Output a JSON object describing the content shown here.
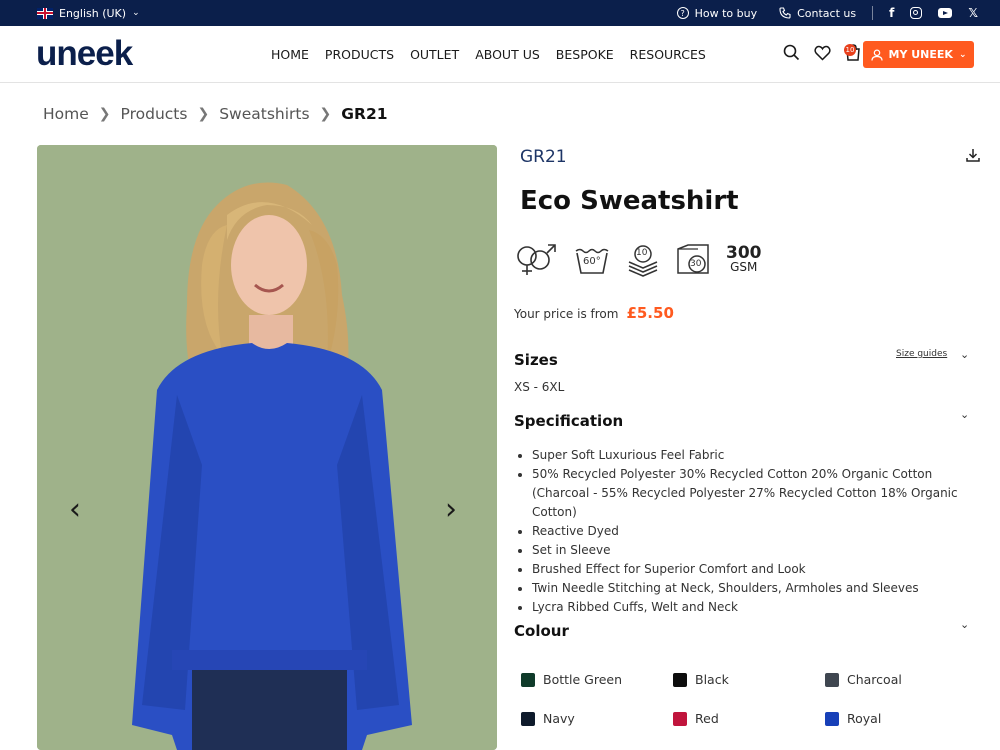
{
  "topbar": {
    "language": "English (UK)",
    "how_to_buy": "How to buy",
    "contact_us": "Contact us"
  },
  "header": {
    "logo": "uneek",
    "nav": [
      "HOME",
      "PRODUCTS",
      "OUTLET",
      "ABOUT US",
      "BESPOKE",
      "RESOURCES"
    ],
    "cart_count": "10",
    "account_label": "MY UNEEK"
  },
  "breadcrumb": [
    "Home",
    "Products",
    "Sweatshirts",
    "GR21"
  ],
  "product": {
    "code": "GR21",
    "name": "Eco Sweatshirt",
    "features": {
      "wash_temp": "60°",
      "layers_label": "10",
      "dry_temp": "30",
      "gsm_value": "300",
      "gsm_unit": "GSM"
    },
    "price_label": "Your price is from",
    "price": "£5.50"
  },
  "sizes": {
    "title": "Sizes",
    "guide_label": "Size guides",
    "range": "XS - 6XL"
  },
  "specification": {
    "title": "Specification",
    "items": [
      "Super Soft Luxurious Feel Fabric",
      "50% Recycled Polyester 30% Recycled Cotton 20% Organic Cotton (Charcoal - 55% Recycled Polyester 27% Recycled Cotton 18% Organic Cotton)",
      "Reactive Dyed",
      "Set in Sleeve",
      "Brushed Effect for Superior Comfort and Look",
      "Twin Needle Stitching at Neck, Shoulders, Armholes and Sleeves",
      "Lycra Ribbed Cuffs, Welt and Neck"
    ]
  },
  "colour": {
    "title": "Colour",
    "swatches": [
      {
        "name": "Bottle Green",
        "hex": "#0f3b2a"
      },
      {
        "name": "Black",
        "hex": "#0d0d0d"
      },
      {
        "name": "Charcoal",
        "hex": "#3f4650"
      },
      {
        "name": "Navy",
        "hex": "#0e1a2b"
      },
      {
        "name": "Red",
        "hex": "#c0143c"
      },
      {
        "name": "Royal",
        "hex": "#1740b8"
      }
    ]
  }
}
